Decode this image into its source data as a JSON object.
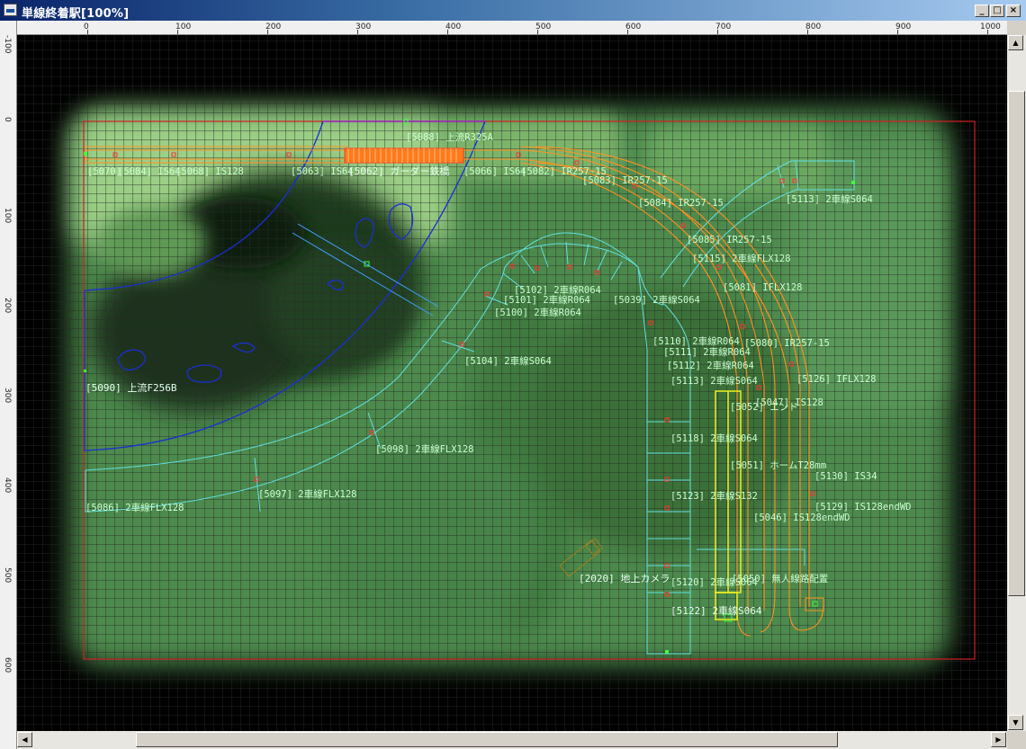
{
  "window": {
    "title": "単線終着駅[100%]",
    "buttons": {
      "minimize": "_",
      "maximize": "□",
      "close": "×"
    }
  },
  "ruler": {
    "h_ticks": [
      "0",
      "100",
      "200",
      "300",
      "400",
      "500",
      "600",
      "700",
      "800",
      "900",
      "1000"
    ],
    "v_ticks": [
      "-100",
      "0",
      "100",
      "200",
      "300",
      "400",
      "500",
      "600"
    ]
  },
  "layout": {
    "labels": [
      "[5088] 上流R325A",
      "[5070]",
      "[5084] IS64",
      "[5068] IS128",
      "[5063] IS64",
      "[5062] ガーダー鉄橋",
      "[5066] IS64",
      "[5082] IR257-15",
      "[5083] IR257-15",
      "[5084] IR257-15",
      "[5085] IR257-15",
      "[5113] 2車線S064",
      "[5115] 2車線FLX128",
      "[5081] IFLX128",
      "[5102] 2車線R064",
      "[5101] 2車線R064",
      "[5039] 2車線S064",
      "[5100] 2車線R064",
      "[5110] 2車線R064",
      "[5111] 2車線R064",
      "[5112] 2車線R064",
      "[5080] IR257-15",
      "[5104] 2車線S064",
      "[5126] IFLX128",
      "[5113] 2車線S064",
      "[5047] IS128",
      "[5052] エンド",
      "[5090] 上流F256B",
      "[5118] 2車線S064",
      "[5098] 2車線FLX128",
      "[5051] ホームT28mm",
      "[5130] IS34",
      "[5097] 2車線FLX128",
      "[5123] 2車線S132",
      "[5129] IS128endWD",
      "[5086] 2車線FLX128",
      "[5046] IS128endWD",
      "[2020] 地上カメラ",
      "[5120] 2車線S064",
      "[5050] 無人線路配置",
      "[5122] 2車線S064"
    ]
  }
}
